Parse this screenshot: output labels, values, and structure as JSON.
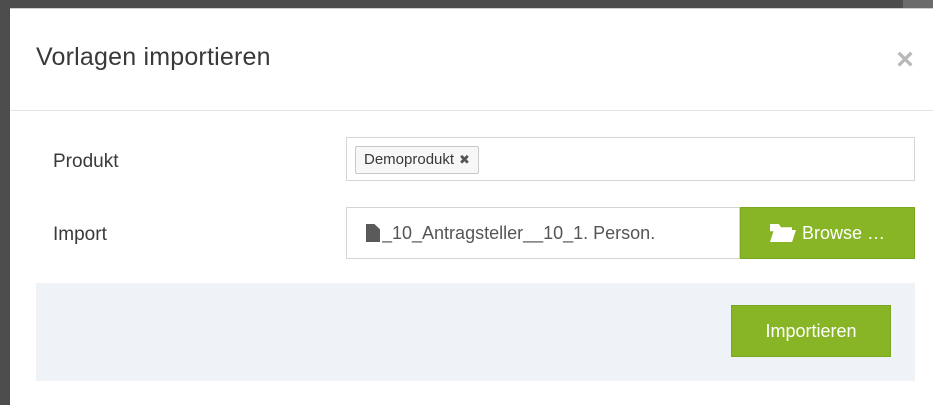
{
  "dialog": {
    "title": "Vorlagen importieren",
    "close_glyph": "×"
  },
  "form": {
    "produkt": {
      "label": "Produkt",
      "tags": [
        {
          "text": "Demoprodukt",
          "remove_glyph": "✖"
        }
      ]
    },
    "import": {
      "label": "Import",
      "file_name": "_10_Antragsteller__10_1. Person.",
      "file_icon": "file-icon",
      "browse_label": "Browse …",
      "browse_icon": "folder-open-icon"
    }
  },
  "footer": {
    "submit_label": "Importieren"
  },
  "colors": {
    "accent_green": "#87b526",
    "footer_bg": "#eff3f8"
  }
}
